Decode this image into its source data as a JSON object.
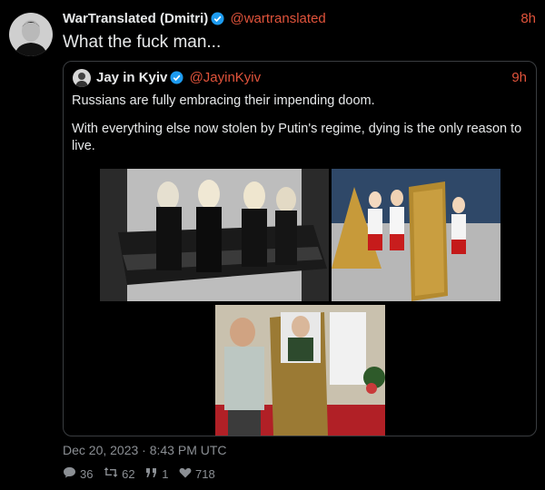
{
  "tweet": {
    "author_name": "WarTranslated (Dmitri)",
    "handle": "@wartranslated",
    "time": "8h",
    "text": "What the fuck man...",
    "date": "Dec 20, 2023 · 8:43 PM UTC",
    "stats": {
      "replies": "36",
      "retweets": "62",
      "quotes": "1",
      "likes": "718"
    }
  },
  "quote": {
    "author_name": "Jay in Kyiv",
    "handle": "@JayinKyiv",
    "time": "9h",
    "paragraphs": [
      "Russians are fully embracing their impending doom.",
      "With everything else now stolen by Putin's regime, dying is the only reason to live."
    ]
  },
  "colors": {
    "background": "#000000",
    "accent_handle": "#e0533b",
    "muted": "#8b8f94",
    "verified": "#1d9bf0",
    "border": "#3a3d40"
  },
  "icons": {
    "verified": "verified-badge-icon",
    "reply": "comment-icon",
    "retweet": "retweet-icon",
    "quote": "quote-icon",
    "like": "heart-icon"
  }
}
